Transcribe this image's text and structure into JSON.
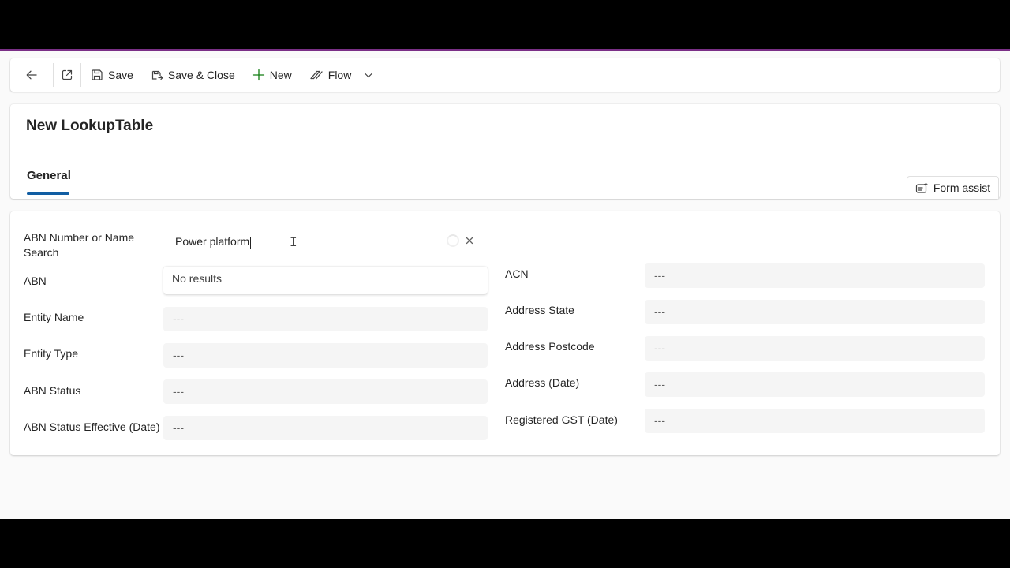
{
  "colors": {
    "accent_line": "#7a2f86",
    "tab_underline": "#115ea3",
    "add_icon": "#107c10"
  },
  "toolbar": {
    "back_icon": "arrow-left-icon",
    "popout_icon": "open-in-new-window-icon",
    "save_label": "Save",
    "save_close_label": "Save & Close",
    "new_label": "New",
    "flow_label": "Flow"
  },
  "header": {
    "title": "New LookupTable",
    "tab_general": "General",
    "form_assist_label": "Form assist"
  },
  "lookup": {
    "label": "ABN Number or Name Search",
    "value": "Power platform",
    "dropdown_text": "No results"
  },
  "left_fields": [
    {
      "label": "ABN",
      "value": ""
    },
    {
      "label": "Entity Name",
      "value": "---"
    },
    {
      "label": "Entity Type",
      "value": "---"
    },
    {
      "label": "ABN Status",
      "value": "---"
    },
    {
      "label": "ABN Status Effective (Date)",
      "value": "---"
    }
  ],
  "right_fields": [
    {
      "label": "ACN",
      "value": "---"
    },
    {
      "label": "Address State",
      "value": "---"
    },
    {
      "label": "Address Postcode",
      "value": "---"
    },
    {
      "label": "Address (Date)",
      "value": "---"
    },
    {
      "label": "Registered GST (Date)",
      "value": "---"
    }
  ]
}
